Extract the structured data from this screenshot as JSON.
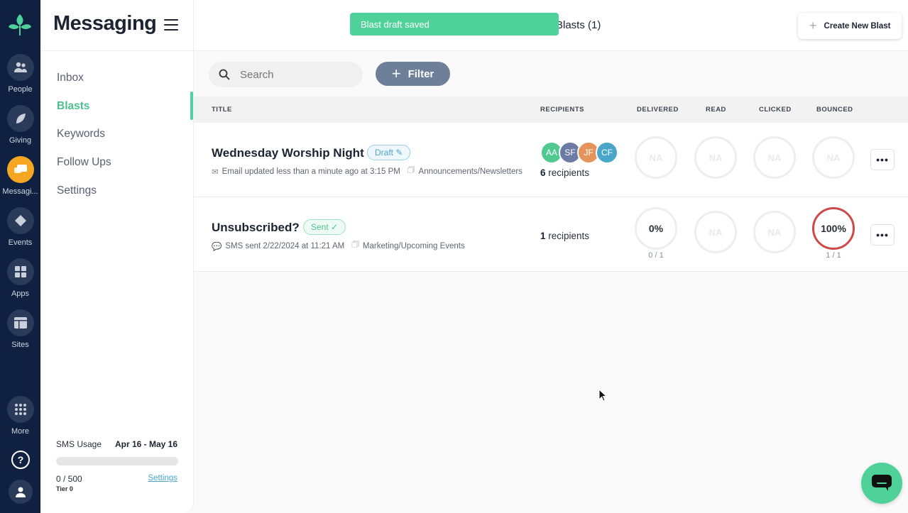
{
  "rail": {
    "items": [
      {
        "label": "People",
        "icon": "people-icon"
      },
      {
        "label": "Giving",
        "icon": "leaf-icon"
      },
      {
        "label": "Messagi...",
        "icon": "chat-icon"
      },
      {
        "label": "Events",
        "icon": "ticket-icon"
      },
      {
        "label": "Apps",
        "icon": "grid-icon"
      },
      {
        "label": "Sites",
        "icon": "browser-icon"
      },
      {
        "label": "More",
        "icon": "dots-grid-icon"
      }
    ],
    "accent": "#f5a623"
  },
  "sidebar": {
    "title": "Messaging",
    "nav": [
      {
        "label": "Inbox"
      },
      {
        "label": "Blasts"
      },
      {
        "label": "Keywords"
      },
      {
        "label": "Follow Ups"
      },
      {
        "label": "Settings"
      }
    ],
    "sms": {
      "label": "SMS Usage",
      "dates": "Apr 16 - May 16",
      "count": "0 / 500",
      "tier": "Tier 0",
      "settings_link": "Settings",
      "usage_fraction": 0
    }
  },
  "header": {
    "heading": "Blasts (1)",
    "toast": "Blast draft saved",
    "create_label": "Create New Blast"
  },
  "toolbar": {
    "search_placeholder": "Search",
    "filter_label": "Filter"
  },
  "table": {
    "headers": {
      "title": "TITLE",
      "recipients": "RECIPIENTS",
      "delivered": "DELIVERED",
      "read": "READ",
      "clicked": "CLICKED",
      "bounced": "BOUNCED"
    },
    "rows": [
      {
        "title": "Wednesday Worship Night",
        "status": "Draft",
        "meta_text": "Email updated less than a minute ago at 3:15 PM",
        "category": "Announcements/Newsletters",
        "avatars": [
          {
            "initials": "AA",
            "color": "#4fc98f"
          },
          {
            "initials": "SF",
            "color": "#6b7ba6"
          },
          {
            "initials": "JF",
            "color": "#e4935a"
          },
          {
            "initials": "CF",
            "color": "#4aa6c9"
          }
        ],
        "recipient_count": "6",
        "recipient_suffix": "recipients",
        "delivered": "NA",
        "read": "NA",
        "clicked": "NA",
        "bounced": "NA"
      },
      {
        "title": "Unsubscribed?",
        "status": "Sent",
        "meta_text": "SMS sent 2/22/2024 at 11:21 AM",
        "category": "Marketing/Upcoming Events",
        "recipient_count": "1",
        "recipient_suffix": "recipients",
        "delivered": "0%",
        "delivered_sub": "0 / 1",
        "read": "NA",
        "clicked": "NA",
        "bounced": "100%",
        "bounced_sub": "1 / 1"
      }
    ]
  },
  "colors": {
    "brand_green": "#4fd19a",
    "rail_bg": "#0f2040",
    "bounce_red": "#cc4a4a"
  }
}
